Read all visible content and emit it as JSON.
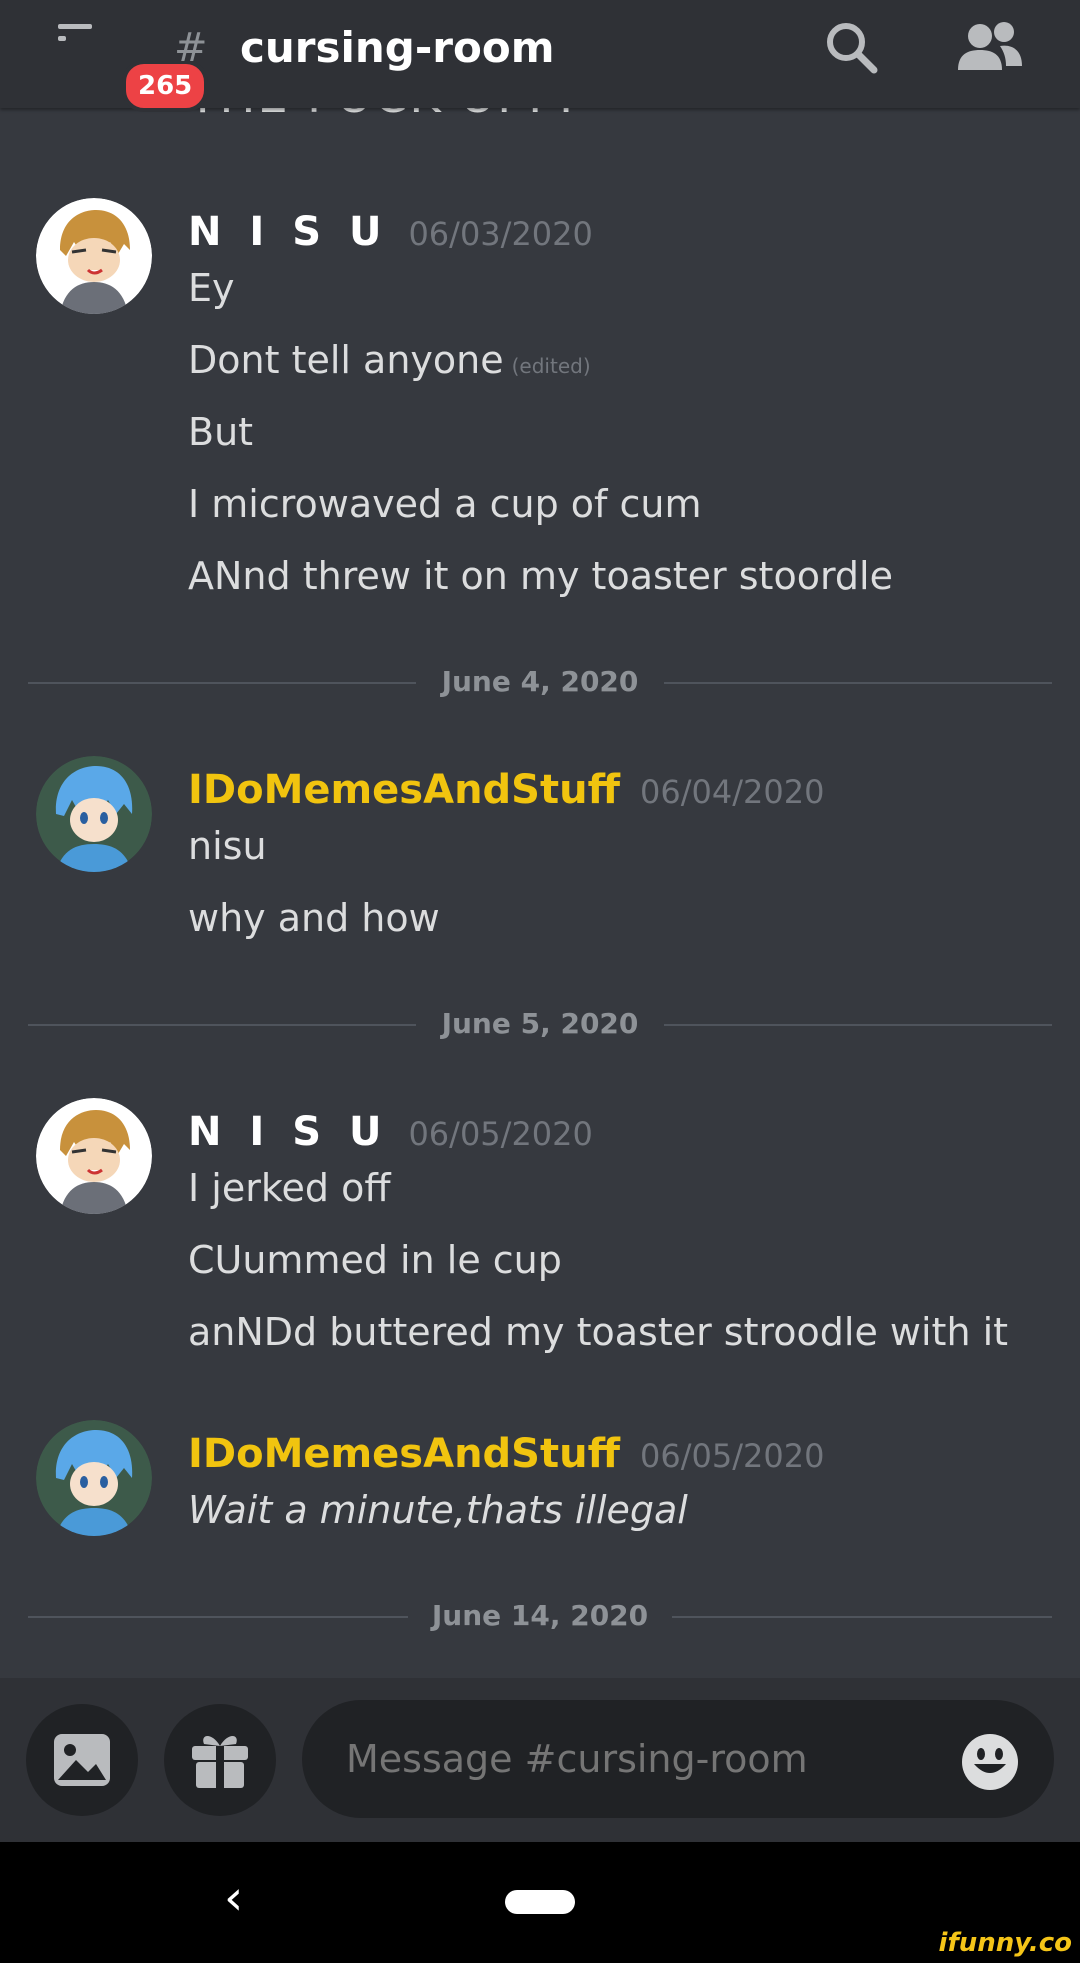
{
  "header": {
    "unread_count": "265",
    "hash": "#",
    "channel_name": "cursing-room"
  },
  "messages": {
    "cut_off_text": "THE FUCK UPPP",
    "groups": [
      {
        "author": "N I S U",
        "author_color": "#ffffff",
        "timestamp": "06/03/2020",
        "lines": [
          "Ey",
          "Dont tell anyone",
          "But",
          "I microwaved a cup of cum",
          "ANnd threw it on my toaster stoordle"
        ],
        "edited_label": "(edited)"
      },
      {
        "author": "IDoMemesAndStuff",
        "author_color": "#f1c40f",
        "timestamp": "06/04/2020",
        "lines": [
          "nisu",
          "why and how"
        ]
      },
      {
        "author": "N I S U",
        "author_color": "#ffffff",
        "timestamp": "06/05/2020",
        "lines": [
          "I jerked off",
          "CUummed in le cup",
          "anNDd buttered my toaster stroodle with it"
        ]
      },
      {
        "author": "IDoMemesAndStuff",
        "author_color": "#f1c40f",
        "timestamp": "06/05/2020",
        "lines": [
          "Wait a minute,thats illegal"
        ]
      }
    ],
    "dividers": [
      "June 4, 2020",
      "June 5, 2020",
      "June 14, 2020"
    ]
  },
  "composer": {
    "placeholder": "Message #cursing-room"
  },
  "nav": {
    "back_glyph": "‹"
  },
  "watermark": "ifunny.co",
  "icons": {
    "menu": "menu-icon",
    "search": "search-icon",
    "members": "members-icon",
    "image": "image-icon",
    "gift": "gift-icon",
    "emoji": "emoji-icon"
  },
  "colors": {
    "background": "#36393f",
    "header": "#2f3136",
    "badge": "#ed4245",
    "username_gold": "#f1c40f"
  }
}
